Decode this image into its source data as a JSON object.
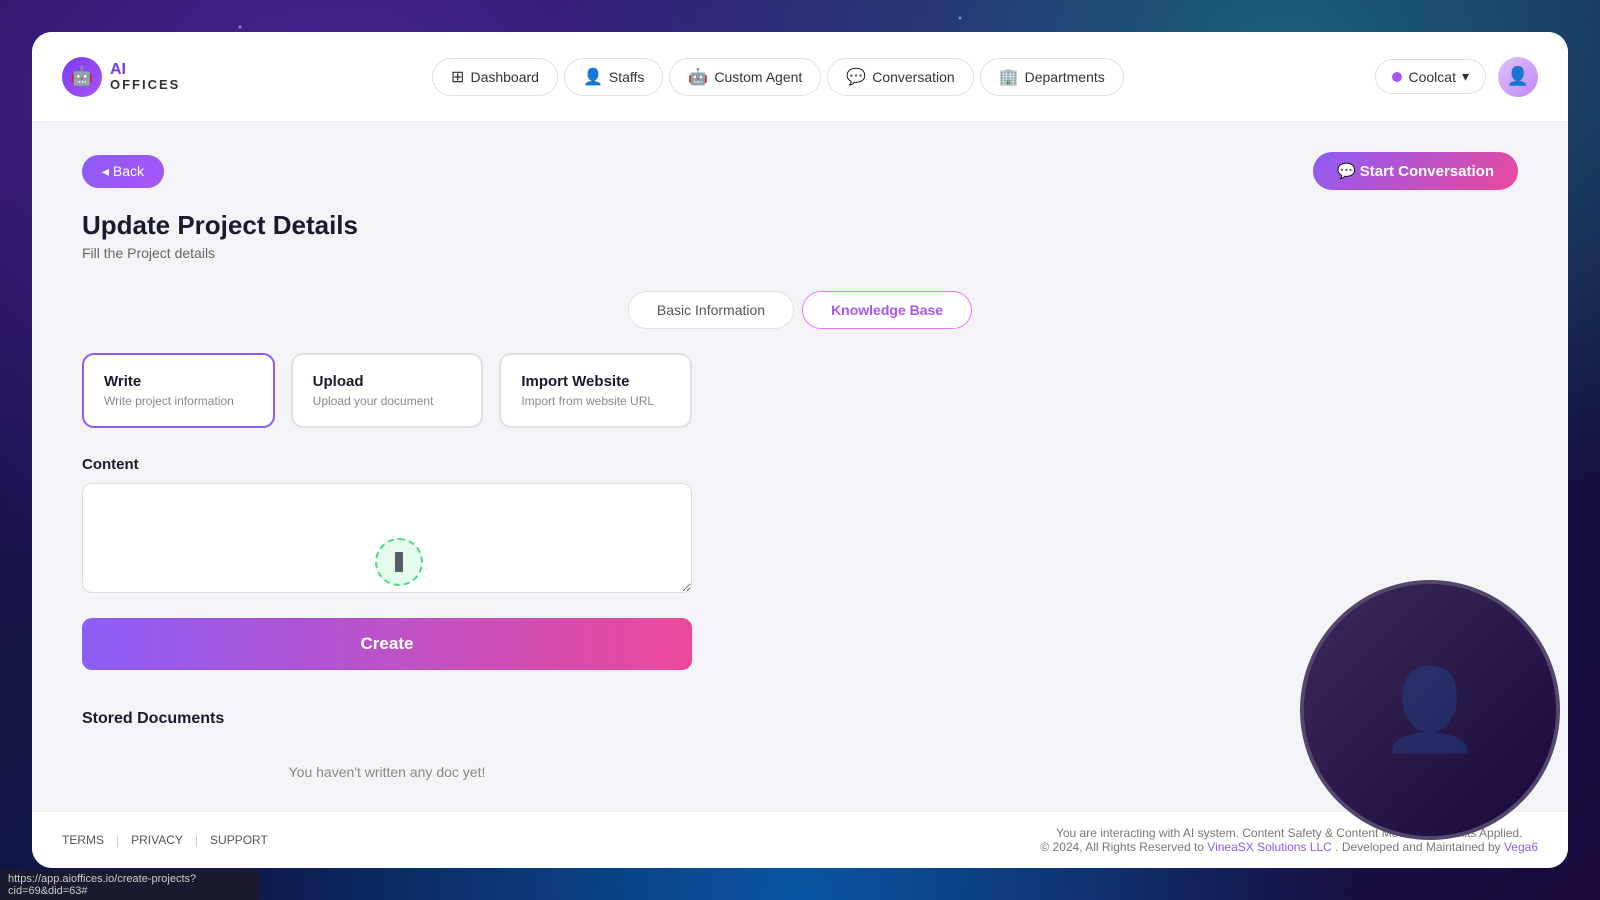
{
  "logo": {
    "ai_text": "AI",
    "offices_text": "OFFICES",
    "icon": "🤖"
  },
  "navbar": {
    "items": [
      {
        "id": "dashboard",
        "label": "Dashboard",
        "icon": "⊞"
      },
      {
        "id": "staffs",
        "label": "Staffs",
        "icon": "👤"
      },
      {
        "id": "custom-agent",
        "label": "Custom Agent",
        "icon": "🤖"
      },
      {
        "id": "conversation",
        "label": "Conversation",
        "icon": "💬"
      },
      {
        "id": "departments",
        "label": "Departments",
        "icon": "🏢"
      }
    ],
    "user": {
      "name": "Coolcat",
      "dropdown_arrow": "▾",
      "avatar": "👤"
    }
  },
  "back_button": "◂ Back",
  "start_conversation_button": "💬 Start Conversation",
  "page": {
    "title": "Update Project Details",
    "subtitle": "Fill the Project details"
  },
  "tabs": [
    {
      "id": "basic-info",
      "label": "Basic Information",
      "active": false
    },
    {
      "id": "knowledge-base",
      "label": "Knowledge Base",
      "active": true
    }
  ],
  "option_cards": [
    {
      "id": "write",
      "title": "Write",
      "subtitle": "Write project information",
      "selected": true
    },
    {
      "id": "upload",
      "title": "Upload",
      "subtitle": "Upload your document",
      "selected": false
    },
    {
      "id": "import-website",
      "title": "Import Website",
      "subtitle": "Import from website URL",
      "selected": false
    }
  ],
  "content": {
    "label": "Content",
    "placeholder": "",
    "value": ""
  },
  "create_button": "Create",
  "stored_documents": {
    "title": "Stored Documents",
    "empty_message": "You haven't written any doc yet!"
  },
  "footer": {
    "links": [
      "TERMS",
      "PRIVACY",
      "SUPPORT"
    ],
    "separators": [
      "|",
      "|"
    ],
    "center_text_1": "You are interacting with AI system. Content Safety & Content Moderation Limits Applied.",
    "center_text_2": "© 2024, All Rights Reserved to ",
    "company_link_text": "VineaSX Solutions LLC",
    "company_link_url": "#",
    "maintained_text": ". Developed and Maintained by ",
    "vega_link": "Vega6"
  },
  "status_bar": {
    "url": "https://app.aioffices.io/create-projects?cid=69&did=63#"
  }
}
